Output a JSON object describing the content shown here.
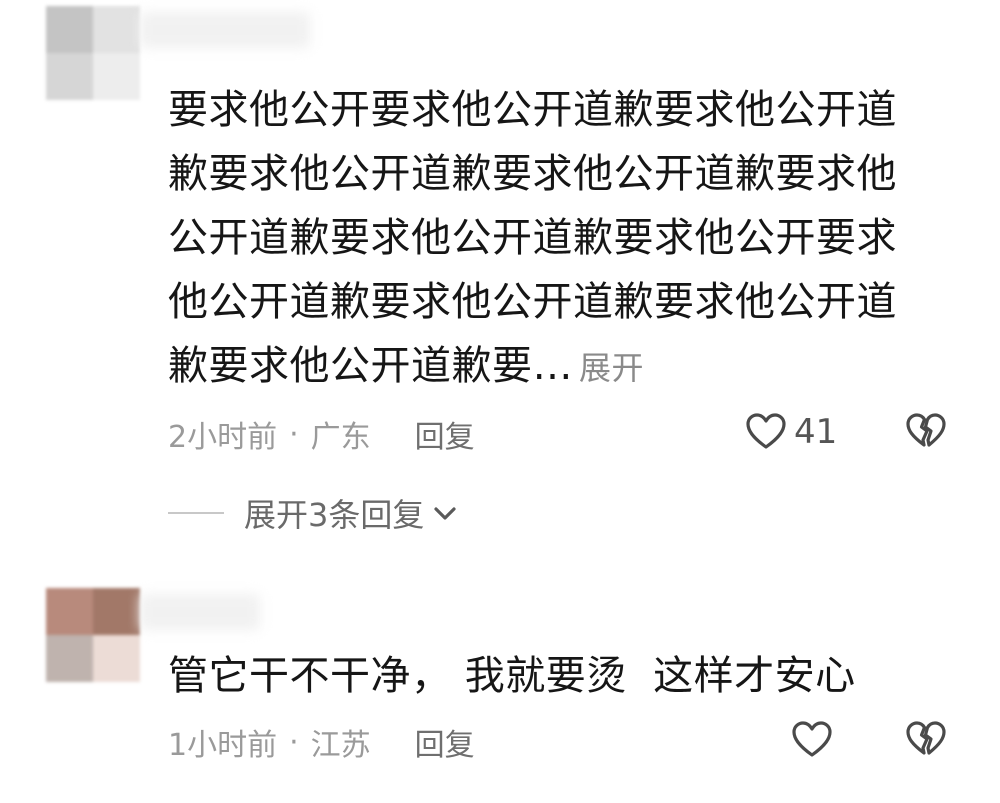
{
  "comments": [
    {
      "text": "要求他公开要求他公开道歉要求他公开道歉要求他公开道歉要求他公开道歉要求他公开道歉要求他公开道歉要求他公开要求他公开道歉要求他公开道歉要求他公开道歉要求他公开道歉要…",
      "expand_label": "展开",
      "time": "2小时前",
      "separator": "·",
      "location": "广东",
      "reply_label": "回复",
      "likes": "41",
      "expand_replies_label": "展开3条回复",
      "icons": {
        "like": "heart-outline-icon",
        "dislike": "broken-heart-icon",
        "expand": "chevron-down-icon"
      }
    },
    {
      "text": "管它干不干净， 我就要烫  这样才安心",
      "time": "1小时前",
      "separator": "·",
      "location": "江苏",
      "reply_label": "回复",
      "icons": {
        "like": "heart-outline-icon",
        "dislike": "broken-heart-icon"
      }
    }
  ],
  "colors": {
    "text": "#161616",
    "meta": "#9a9a9a",
    "icon": "#4a4a4a"
  }
}
